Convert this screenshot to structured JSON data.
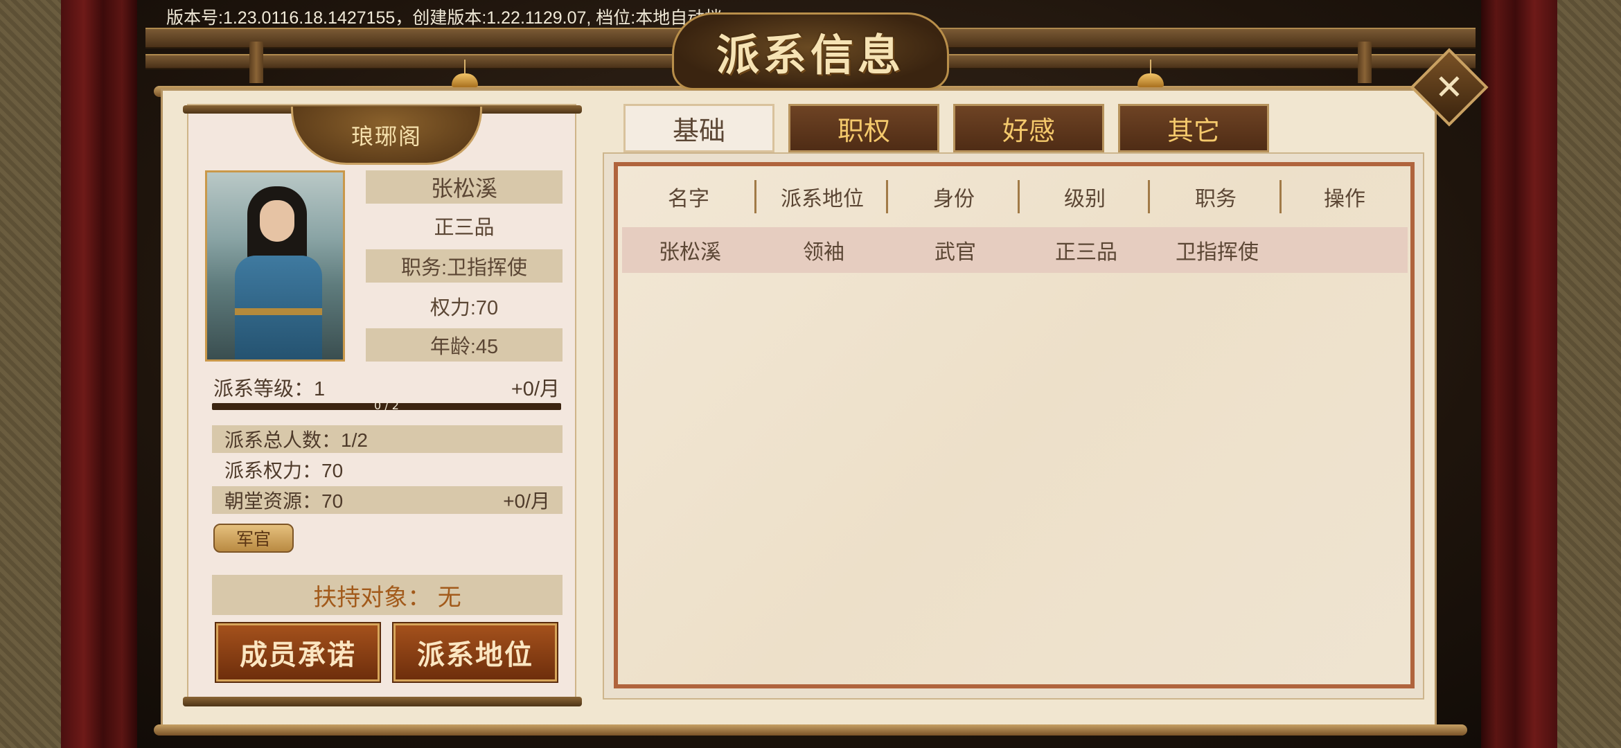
{
  "version_text": "版本号:1.23.0116.18.1427155，创建版本:1.22.1129.07, 档位:本地自动档",
  "title": "派系信息",
  "close_icon": "close-icon",
  "faction": {
    "name": "琅琊阁",
    "leader": {
      "name": "张松溪",
      "rank": "正三品",
      "post": "职务:卫指挥使",
      "power": "权力:70",
      "age": "年龄:45"
    },
    "level_label": "派系等级：1",
    "level_income": "+0/月",
    "level_progress_text": "0 / 2",
    "level_progress": 0.0,
    "total_members": "派系总人数：1/2",
    "faction_power": "派系权力：70",
    "court_resources": "朝堂资源：70",
    "court_income": "+0/月",
    "tag": "军官",
    "support_target": "扶持对象：  无",
    "buttons": {
      "member_promise": "成员承诺",
      "faction_status": "派系地位"
    }
  },
  "tabs": [
    {
      "label": "基础",
      "active": true
    },
    {
      "label": "职权",
      "active": false
    },
    {
      "label": "好感",
      "active": false
    },
    {
      "label": "其它",
      "active": false
    }
  ],
  "table": {
    "headers": [
      "名字",
      "派系地位",
      "身份",
      "级别",
      "职务",
      "操作"
    ],
    "rows": [
      [
        "张松溪",
        "领袖",
        "武官",
        "正三品",
        "卫指挥使",
        ""
      ]
    ]
  },
  "colors": {
    "accent": "#b0643d",
    "tab_inactive_text": "#f4c96c",
    "button_bg": "#8a3f14",
    "support_text": "#a25a1b"
  }
}
